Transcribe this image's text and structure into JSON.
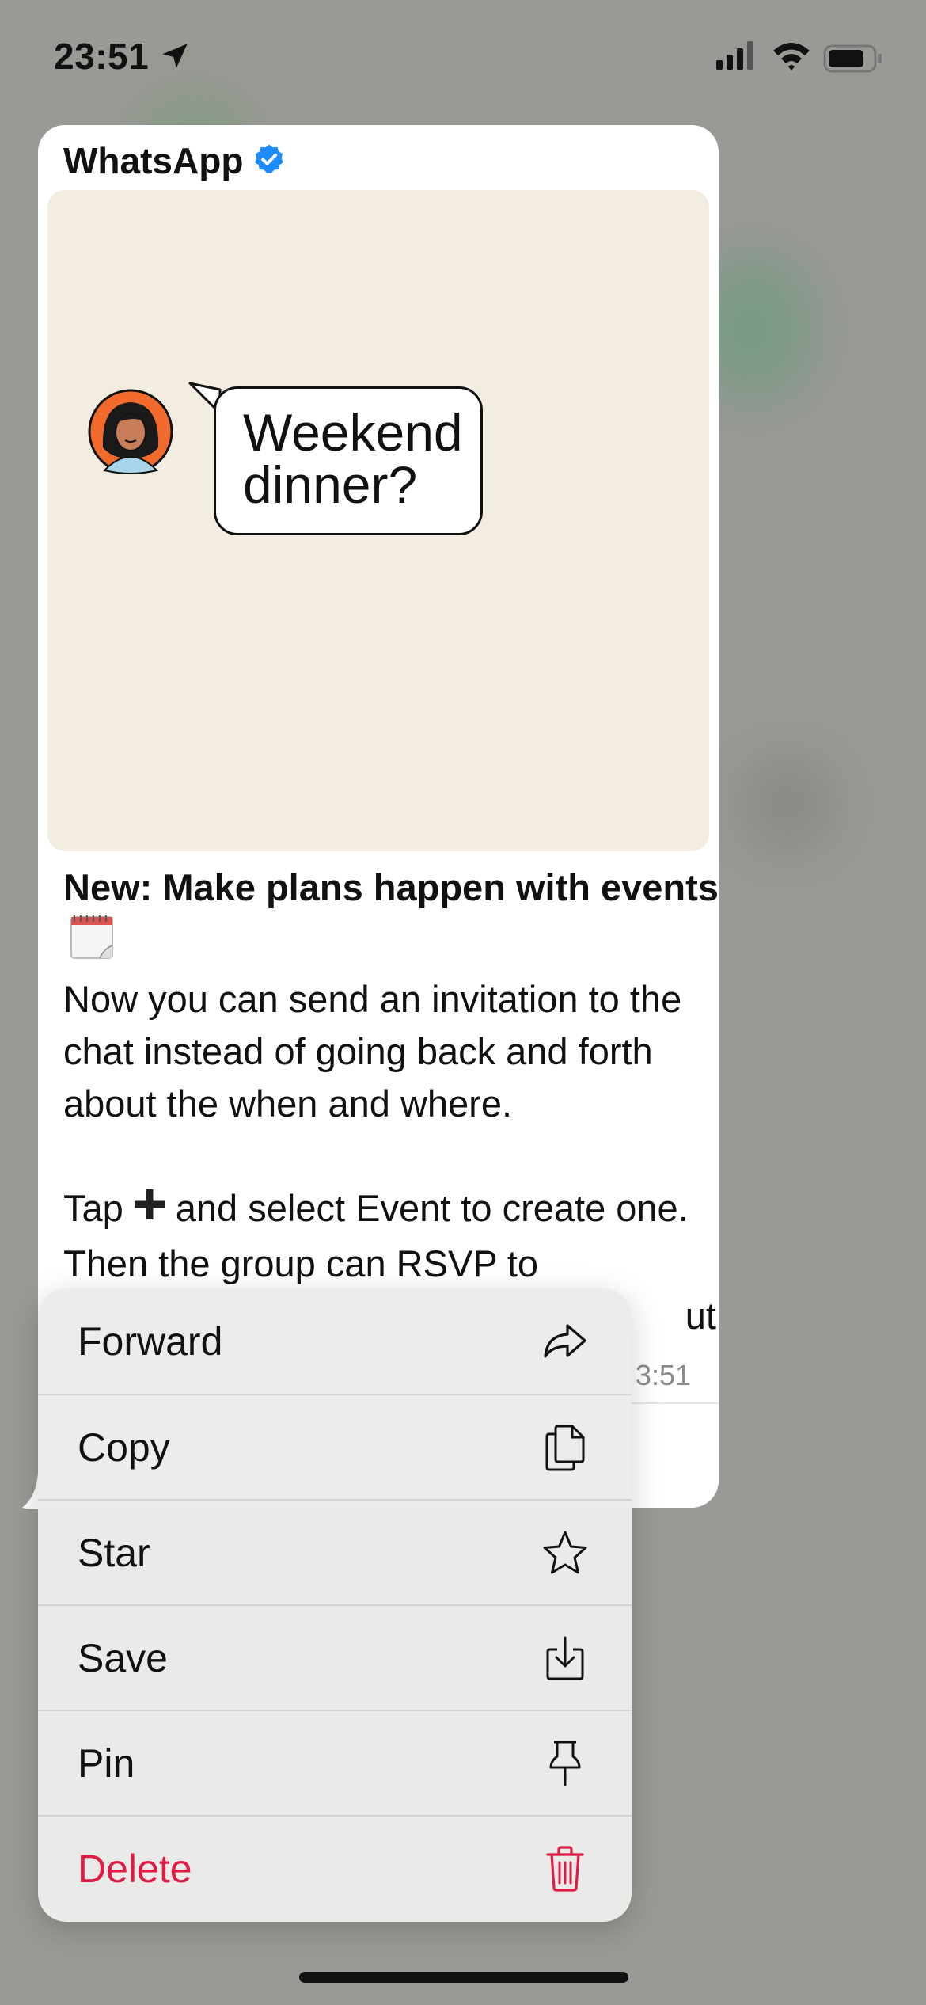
{
  "status_bar": {
    "time": "23:51",
    "location_icon": "location-arrow-icon",
    "signal_icon": "cellular-signal-icon",
    "wifi_icon": "wifi-icon",
    "battery_icon": "battery-icon"
  },
  "message": {
    "sender": "WhatsApp",
    "verified_icon": "verified-badge-icon",
    "image": {
      "bubble_text": "Weekend dinner?",
      "avatar_icon": "woman-avatar-icon"
    },
    "title": "New: Make plans happen with events",
    "title_emoji_icon": "calendar-emoji-icon",
    "body_lines": [
      "Now you can send an invitation to the chat instead of going back and forth about the when and where.",
      "Tap",
      "and select Event to create one. Then the group can RSVP to",
      "ut"
    ],
    "time": "3:51"
  },
  "context_menu": {
    "items": [
      {
        "label": "Forward",
        "icon": "forward-arrow-icon"
      },
      {
        "label": "Copy",
        "icon": "copy-icon"
      },
      {
        "label": "Star",
        "icon": "star-icon"
      },
      {
        "label": "Save",
        "icon": "save-download-icon"
      },
      {
        "label": "Pin",
        "icon": "pin-icon"
      },
      {
        "label": "Delete",
        "icon": "trash-icon",
        "destructive": true
      }
    ]
  },
  "colors": {
    "backdrop": "#9b9995",
    "media_background": "#f2ece1",
    "verified_blue": "#1d8cf8",
    "destructive_red": "#e01b44",
    "avatar_orange": "#f26b2d"
  }
}
